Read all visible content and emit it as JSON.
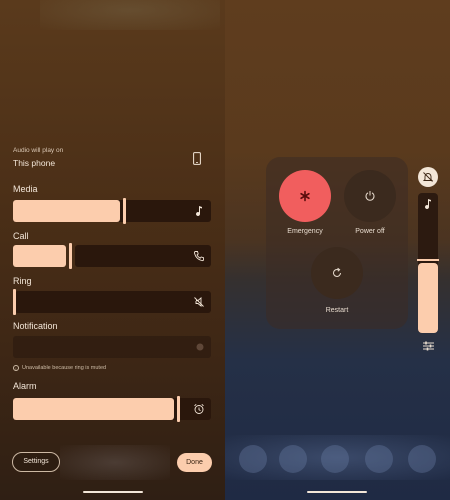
{
  "volume_panel": {
    "output": {
      "label": "Audio will play on",
      "device": "This phone",
      "icon": "phone-icon"
    },
    "streams": [
      {
        "label": "Media",
        "level": 0.55,
        "icon": "music-note-icon",
        "enabled": true
      },
      {
        "label": "Call",
        "level": 0.28,
        "icon": "phone-call-icon",
        "enabled": true
      },
      {
        "label": "Ring",
        "level": 0.0,
        "icon": "ringer-off-icon",
        "enabled": true
      },
      {
        "label": "Notification",
        "level": 0.0,
        "icon": "notification-icon",
        "enabled": false
      },
      {
        "label": "Alarm",
        "level": 0.83,
        "icon": "alarm-icon",
        "enabled": true
      }
    ],
    "notification_note": "Unavailable because ring is muted",
    "settings_label": "Settings",
    "done_label": "Done"
  },
  "power_menu": {
    "emergency_label": "Emergency",
    "power_off_label": "Power off",
    "restart_label": "Restart",
    "emergency_color": "#f15e5e"
  },
  "side_volume": {
    "level": 0.5,
    "ringer_icon": "bell-off-icon",
    "stream_icon": "music-note-icon",
    "settings_icon": "sliders-icon"
  },
  "colors": {
    "accent": "#fccdad",
    "track": "#2a170c"
  }
}
